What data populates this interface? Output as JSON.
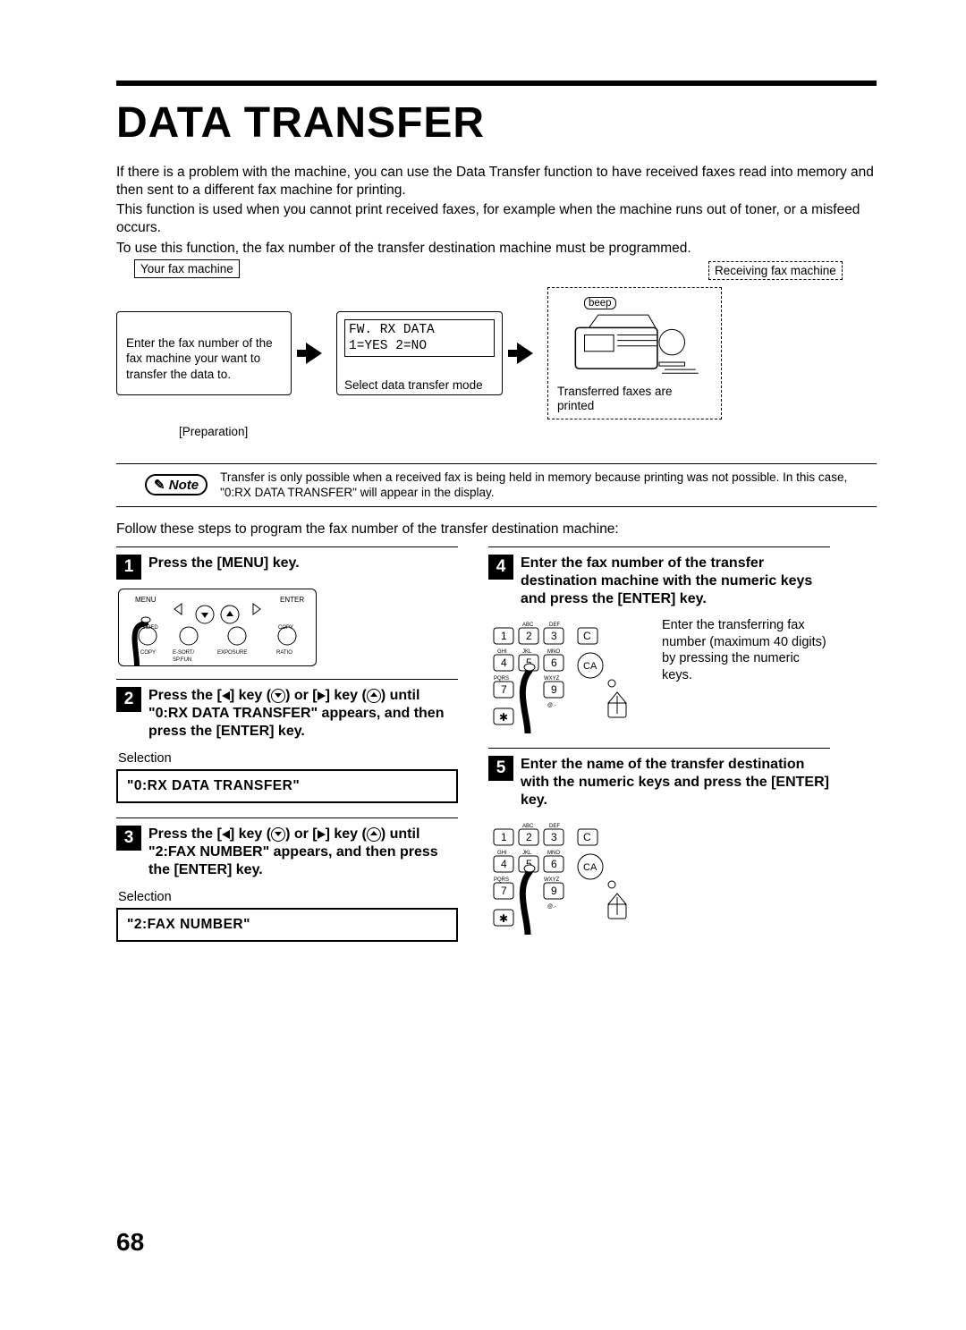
{
  "title": "DATA TRANSFER",
  "intro": {
    "p1": "If there is a problem with the machine, you can use the Data Transfer function to have received faxes read into memory and then sent to a different fax machine for printing.",
    "p2": "This function is used when you cannot print received faxes, for example when the machine runs out of toner, or a misfeed occurs.",
    "p3": "To use this function, the fax number of the transfer destination machine must be programmed."
  },
  "diagram": {
    "your_machine_label": "Your fax machine",
    "recv_machine_label": "Receiving fax machine",
    "panel1_text": "Enter the fax number of the fax machine your want to transfer the data to.",
    "lcd_line1": "FW. RX DATA",
    "lcd_line2": "1=YES   2=NO",
    "panel2_caption": "Select data transfer mode",
    "beep": "beep",
    "recv_caption": "Transferred faxes are printed",
    "preparation": "[Preparation]"
  },
  "note": {
    "label": "Note",
    "text": "Transfer is only possible when a received fax is being held in memory because printing was not possible. In this case, \"0:RX DATA TRANSFER\" will appear in the display."
  },
  "follow_text": "Follow these steps to program the fax number of the transfer destination machine:",
  "steps": {
    "s1": {
      "num": "1",
      "title": "Press the [MENU] key."
    },
    "s2": {
      "num": "2",
      "title_pre": "Press the [",
      "title_mid": "] key (",
      "title_or": ") or [",
      "title_mid2": "] key (",
      "title_end": ") until \"0:RX DATA TRANSFER\" appears, and then press the [ENTER] key.",
      "sel": "Selection",
      "display": "\"0:RX DATA TRANSFER\""
    },
    "s3": {
      "num": "3",
      "title_pre": "Press the [",
      "title_mid": "] key (",
      "title_or": ") or [",
      "title_mid2": "] key (",
      "title_end": ") until \"2:FAX NUMBER\" appears, and then press the [ENTER] key.",
      "sel": "Selection",
      "display": "\"2:FAX NUMBER\""
    },
    "s4": {
      "num": "4",
      "title": "Enter the fax number of the transfer destination machine with the numeric keys and press the [ENTER] key.",
      "side": "Enter the transferring fax number (maximum 40 digits) by pressing the numeric keys."
    },
    "s5": {
      "num": "5",
      "title": "Enter the name of the transfer destination with the numeric keys and press the [ENTER] key."
    }
  },
  "keypad": {
    "keys": [
      "1",
      "2",
      "3",
      "4",
      "5",
      "6",
      "7",
      "",
      "9",
      "✱"
    ],
    "sub": [
      "",
      "ABC",
      "DEF",
      "GHI",
      "JKL",
      "MNO",
      "PQRS",
      "",
      "WXYZ"
    ],
    "c": "C",
    "ca": "CA"
  },
  "menu_panel_labels": {
    "menu": "MENU",
    "enter": "ENTER",
    "twoside": "2-SIDED COPY",
    "esort": "E-SORT/ SP.FUN",
    "exposure": "EXPOSURE",
    "ratio": "COPY RATIO"
  },
  "page_number": "68"
}
